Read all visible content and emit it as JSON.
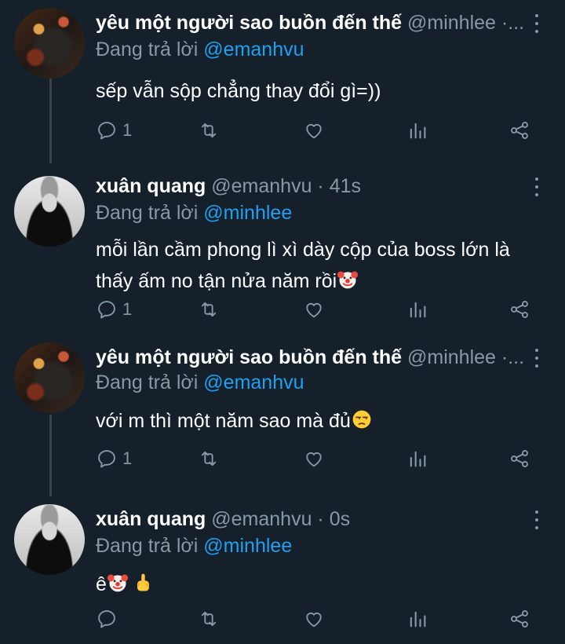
{
  "tweets": [
    {
      "name": "yêu một người sao buồn đến thế",
      "handle": "@minhlee ·...",
      "replying_prefix": "Đang trả lời",
      "replying_to": "@emanhvu",
      "text": "sếp vẫn sộp chẳng thay đổi gì=))",
      "reply_count": "1",
      "avatar": "moody-night-photo"
    },
    {
      "name": "xuân quang",
      "handle": "@emanhvu · 41s",
      "replying_prefix": "Đang trả lời",
      "replying_to": "@minhlee",
      "text_line1": "mỗi lần cầm phong lì xì dày cộp của boss lớn là",
      "text_line2": "thấy ấm no tận nửa năm rồi",
      "reply_count": "1",
      "avatar": "bw-portrait",
      "emoji": "clown-face"
    },
    {
      "name": "yêu một người sao buồn đến thế",
      "handle": "@minhlee ·...",
      "replying_prefix": "Đang trả lời",
      "replying_to": "@emanhvu",
      "text": "với m thì một năm sao mà đủ",
      "reply_count": "1",
      "avatar": "moody-night-photo",
      "emoji": "unamused-face"
    },
    {
      "name": "xuân quang",
      "handle": "@emanhvu · 0s",
      "replying_prefix": "Đang trả lời",
      "replying_to": "@minhlee",
      "text": "ê",
      "reply_count": "",
      "avatar": "bw-portrait",
      "emoji": [
        "clown-face",
        "middle-finger"
      ]
    }
  ],
  "icons": [
    "reply-icon",
    "retweet-icon",
    "like-icon",
    "stats-icon",
    "share-icon",
    "more-icon"
  ],
  "colors": {
    "background": "#15202b",
    "muted": "#8899a6",
    "link": "#1da1f2",
    "thread": "#38444d"
  }
}
